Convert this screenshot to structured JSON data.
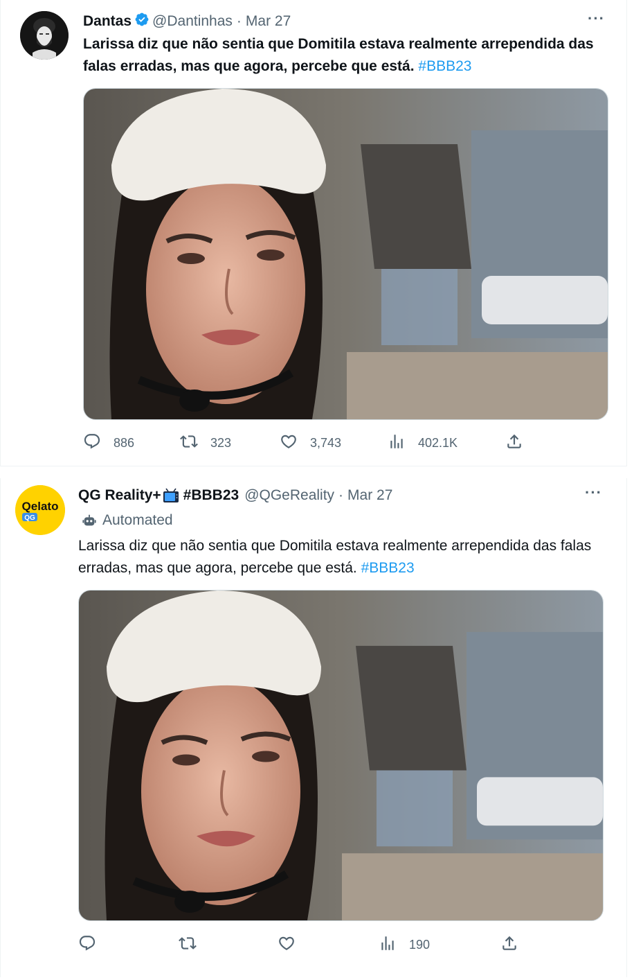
{
  "tweet1": {
    "display_name": "Dantas",
    "handle": "@Dantinhas",
    "sep": "·",
    "date": "Mar 27",
    "more": "···",
    "text": "Larissa diz que não sentia que Domitila estava realmente arrependida das falas erradas, mas que agora, percebe que está.",
    "hashtag": "#BBB23",
    "stats": {
      "replies": "886",
      "retweets": "323",
      "likes": "3,743",
      "views": "402.1K"
    }
  },
  "tweet2": {
    "display_name": "QG Reality+",
    "display_emoji": "📺",
    "display_tag": "#BBB23",
    "handle": "@QGeReality",
    "sep": "·",
    "date": "Mar 27",
    "more": "···",
    "automated_label": "Automated",
    "text": "Larissa diz que não sentia que Domitila estava realmente arrependida das falas erradas, mas que agora, percebe que está.",
    "hashtag": "#BBB23",
    "avatar_text": "Qelato",
    "avatar_sub": "QG",
    "stats": {
      "views": "190"
    }
  },
  "colors": {
    "link": "#1d9bf0",
    "muted": "#536471",
    "verified": "#1d9bf0",
    "avatar2_bg": "#ffd200"
  },
  "icons": [
    "verified-badge-icon",
    "reply-icon",
    "retweet-icon",
    "like-icon",
    "views-icon",
    "share-icon",
    "robot-icon",
    "tv-icon"
  ]
}
